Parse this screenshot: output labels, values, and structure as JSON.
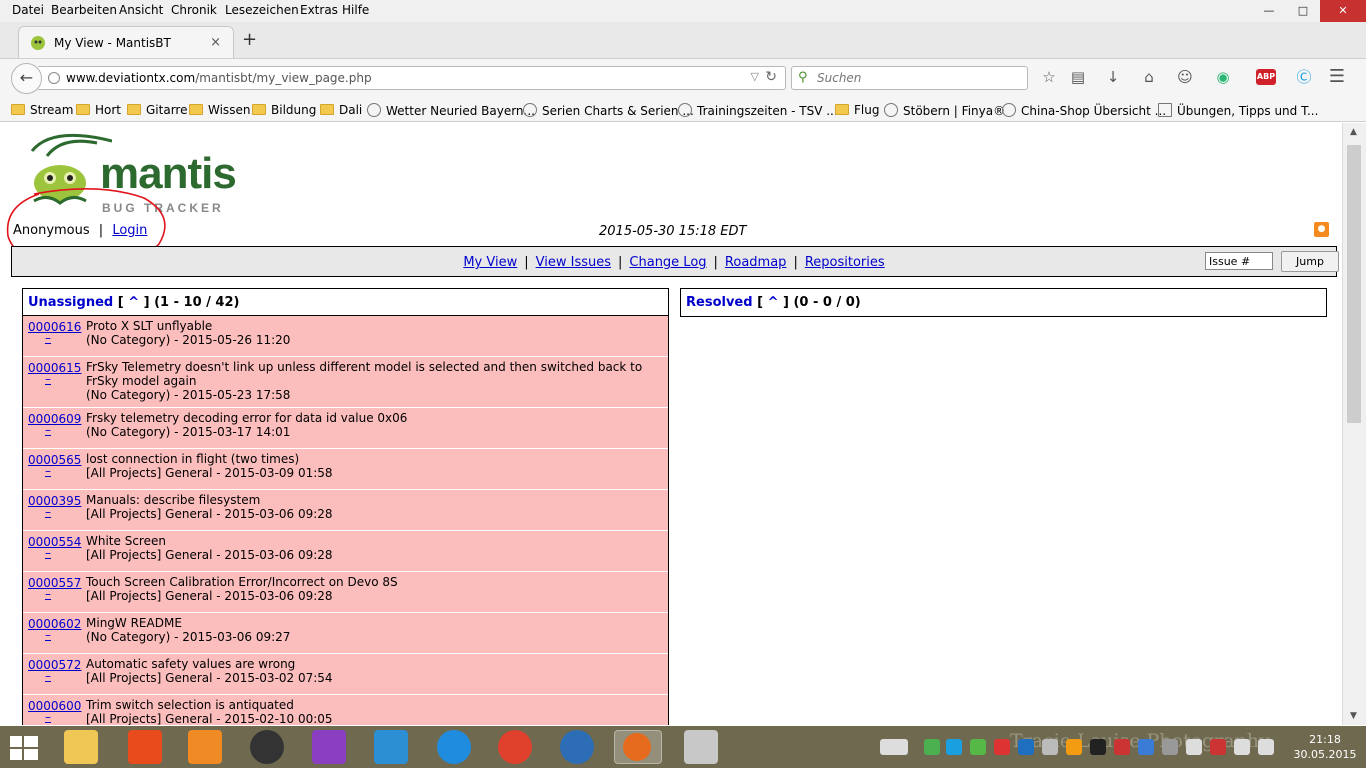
{
  "menubar": {
    "items": [
      "Datei",
      "Bearbeiten",
      "Ansicht",
      "Chronik",
      "Lesezeichen",
      "Extras",
      "Hilfe"
    ]
  },
  "tab": {
    "title": "My View - MantisBT",
    "close": "×"
  },
  "newtab": "+",
  "urlbar": {
    "host": "www.deviationtx.com",
    "path": "/mantisbt/my_view_page.php"
  },
  "search": {
    "placeholder": "Suchen"
  },
  "bookmarks": [
    "Stream",
    "Hort",
    "Gitarre",
    "Wissen",
    "Bildung",
    "Dali",
    "Wetter Neuried Bayern...",
    "Serien Charts & Serien ...",
    "Trainingszeiten - TSV ...",
    "Flug",
    "Stöbern | Finya®",
    "China-Shop Übersicht ...",
    "Übungen, Tipps und T..."
  ],
  "page": {
    "logo": {
      "word": "mantis",
      "sub": "BUG TRACKER"
    },
    "user": "Anonymous",
    "separator": "|",
    "login_label": "Login",
    "datetime": "2015-05-30 15:18 EDT",
    "menu": [
      "My View",
      "View Issues",
      "Change Log",
      "Roadmap",
      "Repositories"
    ],
    "issue_placeholder": "Issue #",
    "jump_label": "Jump",
    "unassigned": {
      "title": "Unassigned",
      "caret": "^",
      "range": "(1 - 10 / 42)"
    },
    "resolved": {
      "title": "Resolved",
      "caret": "^",
      "range": "(0 - 0 / 0)"
    },
    "issues": [
      {
        "id": "0000616",
        "summary": "Proto X SLT unflyable",
        "meta": "(No Category) - 2015-05-26 11:20"
      },
      {
        "id": "0000615",
        "summary": "FrSky Telemetry doesn't link up unless different model is selected and then switched back to FrSky model again",
        "meta": "(No Category) - 2015-05-23 17:58"
      },
      {
        "id": "0000609",
        "summary": "Frsky telemetry decoding error for data id value 0x06",
        "meta": "(No Category) - 2015-03-17 14:01"
      },
      {
        "id": "0000565",
        "summary": "lost connection in flight (two times)",
        "meta": "[All Projects] General - 2015-03-09 01:58"
      },
      {
        "id": "0000395",
        "summary": "Manuals: describe filesystem",
        "meta": "[All Projects] General - 2015-03-06 09:28"
      },
      {
        "id": "0000554",
        "summary": "White Screen",
        "meta": "[All Projects] General - 2015-03-06 09:28"
      },
      {
        "id": "0000557",
        "summary": "Touch Screen Calibration Error/Incorrect on Devo 8S",
        "meta": "[All Projects] General - 2015-03-06 09:28"
      },
      {
        "id": "0000602",
        "summary": "MingW README",
        "meta": "(No Category) - 2015-03-06 09:27"
      },
      {
        "id": "0000572",
        "summary": "Automatic safety values are wrong",
        "meta": "[All Projects] General - 2015-03-02 07:54"
      },
      {
        "id": "0000600",
        "summary": "Trim switch selection is antiquated",
        "meta": "[All Projects] General - 2015-02-10 00:05"
      }
    ]
  },
  "taskbar": {
    "watermark": "Tracie Louise Photography",
    "time": "21:18",
    "date": "30.05.2015"
  },
  "colors": {
    "issue_row": "#fcbdbd",
    "link": "#0000cc",
    "logo_green": "#2d6a2f",
    "taskbar": "#6f6a4f",
    "annotation_circle": "#e0141b"
  }
}
